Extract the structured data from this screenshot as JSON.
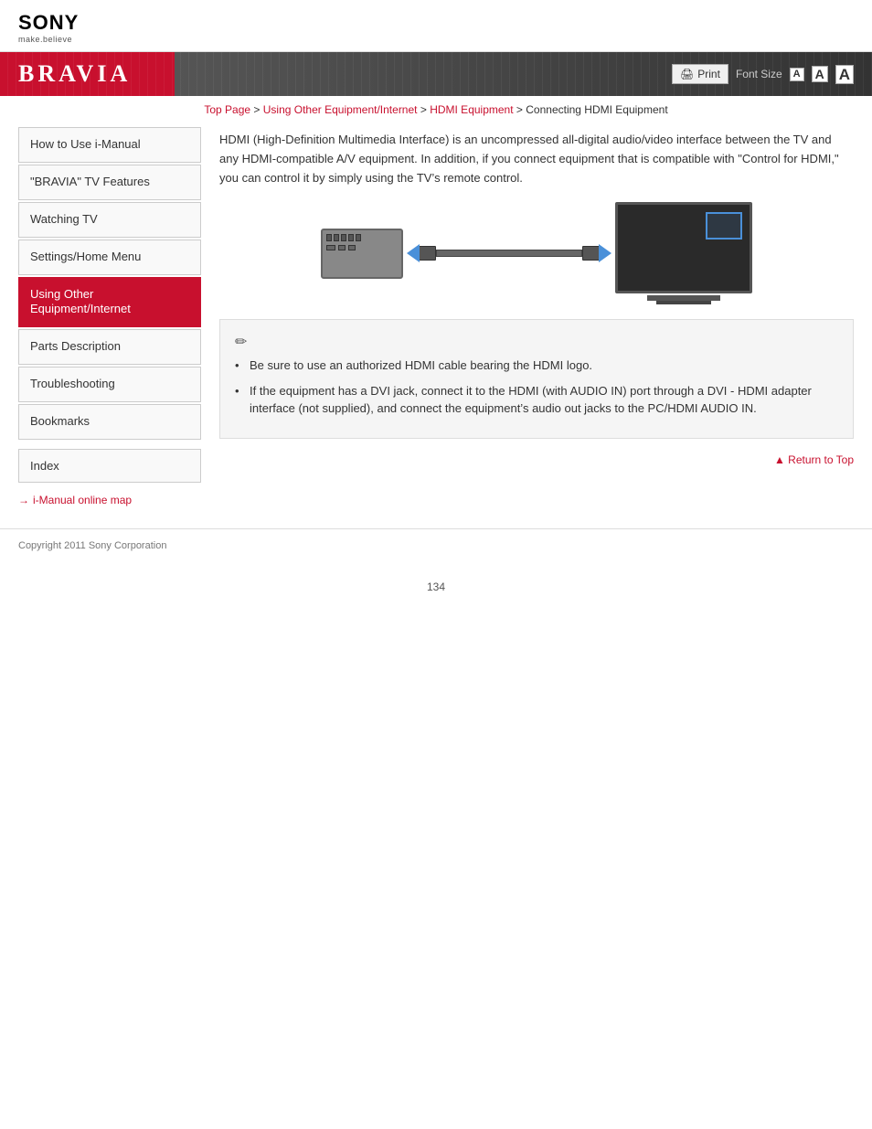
{
  "header": {
    "logo_name": "SONY",
    "logo_tagline": "make.believe",
    "bravia_title": "BRAVIA",
    "print_label": "Print",
    "font_size_label": "Font Size",
    "font_small": "A",
    "font_medium": "A",
    "font_large": "A"
  },
  "breadcrumb": {
    "top_page": "Top Page",
    "separator1": " > ",
    "link2": "Using Other Equipment/Internet",
    "separator2": " > ",
    "link3": "HDMI Equipment",
    "separator3": " > ",
    "current": "Connecting HDMI Equipment"
  },
  "sidebar": {
    "items": [
      {
        "id": "how-to-use",
        "label": "How to Use i-Manual",
        "active": false
      },
      {
        "id": "bravia-features",
        "label": "\"BRAVIA\" TV Features",
        "active": false
      },
      {
        "id": "watching-tv",
        "label": "Watching TV",
        "active": false
      },
      {
        "id": "settings-home",
        "label": "Settings/Home Menu",
        "active": false
      },
      {
        "id": "using-other",
        "label": "Using Other Equipment/Internet",
        "active": true
      },
      {
        "id": "parts-desc",
        "label": "Parts Description",
        "active": false
      },
      {
        "id": "troubleshooting",
        "label": "Troubleshooting",
        "active": false
      },
      {
        "id": "bookmarks",
        "label": "Bookmarks",
        "active": false
      }
    ],
    "index_label": "Index",
    "online_map_label": "i-Manual online map"
  },
  "content": {
    "page_title": "Connecting HDMI Equipment",
    "description": "HDMI (High-Definition Multimedia Interface) is an uncompressed all-digital audio/video interface between the TV and any HDMI-compatible A/V equipment. In addition, if you connect equipment that is compatible with \"Control for HDMI,\" you can control it by simply using the TV’s remote control.",
    "notes": {
      "icon": "✏",
      "items": [
        "Be sure to use an authorized HDMI cable bearing the HDMI logo.",
        "If the equipment has a DVI jack, connect it to the HDMI (with AUDIO IN) port through a DVI - HDMI adapter interface (not supplied), and connect the equipment’s audio out jacks to the PC/HDMI AUDIO IN."
      ]
    },
    "return_top_label": "Return to Top"
  },
  "footer": {
    "copyright": "Copyright 2011 Sony Corporation"
  },
  "page_number": "134"
}
